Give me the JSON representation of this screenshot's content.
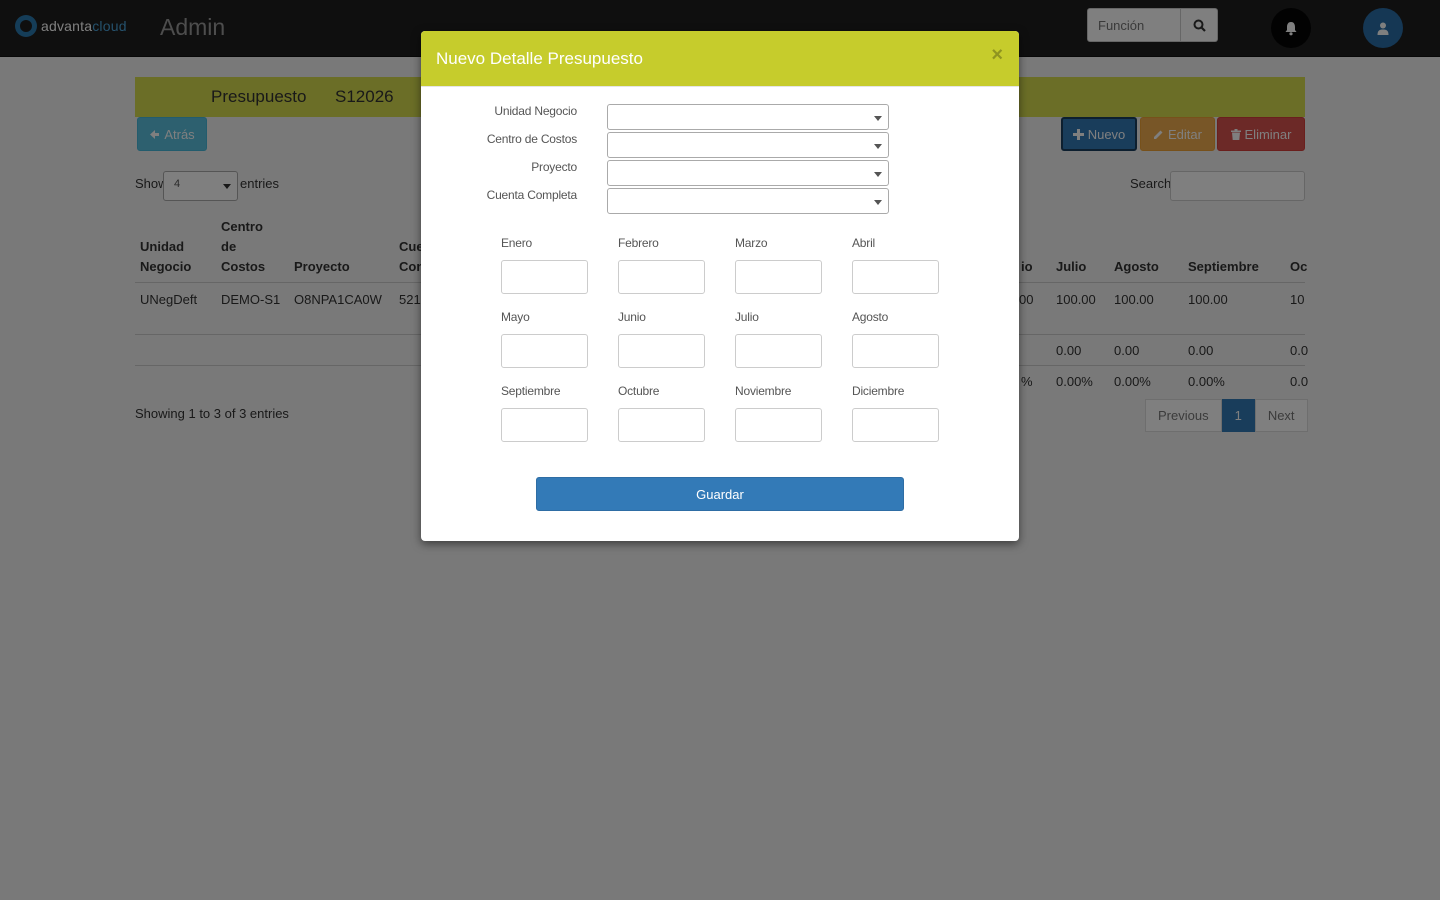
{
  "topbar": {
    "logo_prefix": "advanta",
    "logo_suffix": "cloud",
    "app_title": "Admin",
    "search_placeholder": "Función"
  },
  "page": {
    "title_label": "Presupuesto",
    "title_code": "S12026",
    "buttons": {
      "back": "Atrás",
      "new": "Nuevo",
      "edit": "Editar",
      "delete": "Eliminar"
    },
    "show_label": "Show",
    "show_value": "4",
    "entries_label": "entries",
    "search_label": "Search:",
    "table": {
      "headers_left": [
        "Unidad\nNegocio",
        "Centro\nde\nCostos",
        "Proyecto",
        "Cue\nCon"
      ],
      "headers_right": [
        "io",
        "Julio",
        "Agosto",
        "Septiembre",
        "Oc"
      ],
      "row1_left": [
        "UNegDeft",
        "DEMO-S1",
        "O8NPA1CA0W",
        "521"
      ],
      "row1_right": [
        "00",
        "100.00",
        "100.00",
        "100.00",
        "10"
      ],
      "row2_right": [
        "0.00",
        "0.00",
        "0.00",
        "0.0"
      ],
      "row3_right": [
        "%",
        "0.00%",
        "0.00%",
        "0.00%",
        "0.0"
      ]
    },
    "info": "Showing 1 to 3 of 3 entries",
    "pager": {
      "previous": "Previous",
      "current": "1",
      "next": "Next"
    }
  },
  "modal": {
    "title": "Nuevo Detalle Presupuesto",
    "close": "×",
    "selects": [
      {
        "label": "Unidad Negocio",
        "value": ""
      },
      {
        "label": "Centro de Costos",
        "value": ""
      },
      {
        "label": "Proyecto",
        "value": ""
      },
      {
        "label": "Cuenta Completa",
        "value": ""
      }
    ],
    "months": [
      "Enero",
      "Febrero",
      "Marzo",
      "Abril",
      "Mayo",
      "Junio",
      "Julio",
      "Agosto",
      "Septiembre",
      "Octubre",
      "Noviembre",
      "Diciembre"
    ],
    "save_label": "Guardar"
  },
  "colors": {
    "band": "#d6dc4e",
    "modal_header": "#c6cc2c",
    "primary": "#337ab7",
    "info": "#5bc0de",
    "warning": "#f0ad4e",
    "danger": "#d9534f"
  }
}
